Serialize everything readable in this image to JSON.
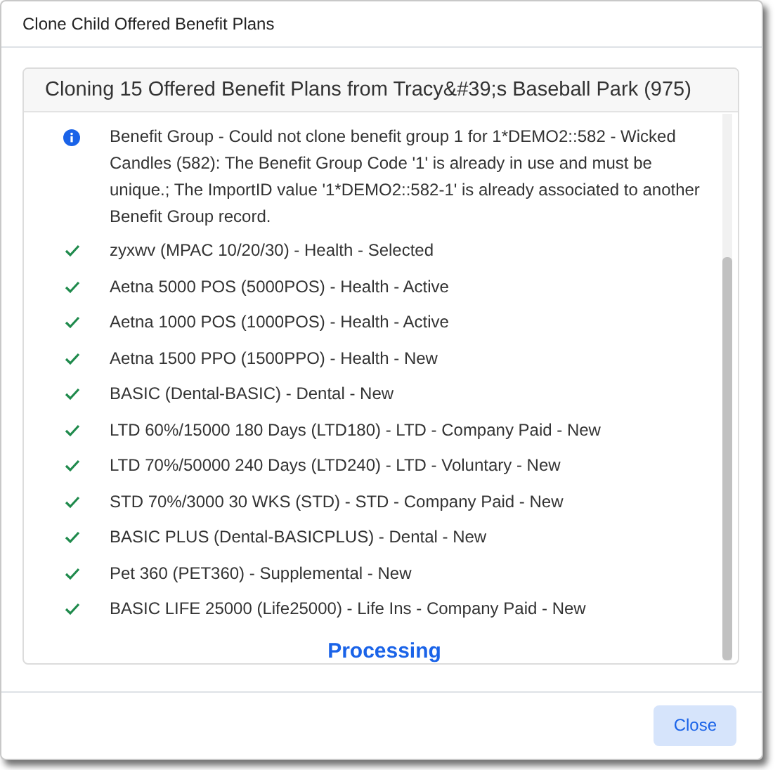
{
  "dialog": {
    "title": "Clone Child Offered Benefit Plans"
  },
  "panel": {
    "heading": "Cloning 15 Offered Benefit Plans from Tracy&#39;s Baseball Park (975)",
    "results": [
      {
        "kind": "info",
        "text": "Benefit Group - Could not clone benefit group 1 for 1*DEMO2::582 - Wicked Candles (582): The Benefit Group Code '1' is already in use and must be unique.; The ImportID value '1*DEMO2::582-1' is already associated to another Benefit Group record."
      },
      {
        "kind": "success",
        "text": "zyxwv (MPAC 10/20/30) - Health - Selected"
      },
      {
        "kind": "success",
        "text": "Aetna 5000 POS (5000POS) - Health - Active"
      },
      {
        "kind": "success",
        "text": "Aetna 1000 POS (1000POS) - Health - Active"
      },
      {
        "kind": "success",
        "text": "Aetna 1500 PPO (1500PPO) - Health - New"
      },
      {
        "kind": "success",
        "text": "BASIC (Dental-BASIC) - Dental - New"
      },
      {
        "kind": "success",
        "text": "LTD 60%/15000 180 Days (LTD180) - LTD - Company Paid - New"
      },
      {
        "kind": "success",
        "text": "LTD 70%/50000 240 Days (LTD240) - LTD - Voluntary - New"
      },
      {
        "kind": "success",
        "text": "STD 70%/3000 30 WKS (STD) - STD - Company Paid - New"
      },
      {
        "kind": "success",
        "text": "BASIC PLUS (Dental-BASICPLUS) - Dental - New"
      },
      {
        "kind": "success",
        "text": "Pet 360 (PET360) - Supplemental - New"
      },
      {
        "kind": "success",
        "text": "BASIC LIFE 25000 (Life25000) - Life Ins - Company Paid - New"
      }
    ],
    "status": "Processing"
  },
  "buttons": [
    "Close"
  ]
}
